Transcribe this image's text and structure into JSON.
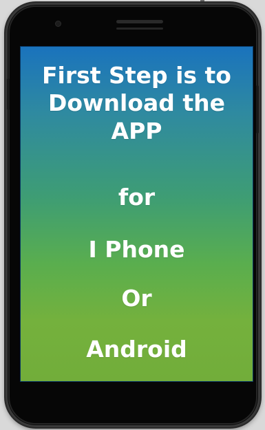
{
  "screen": {
    "lines": [
      "First Step is to",
      "Download the",
      "APP",
      "for",
      "I Phone",
      "Or",
      "Android"
    ],
    "gradient_colors": [
      "#1a73bd",
      "#3e9d74",
      "#74b13d"
    ]
  },
  "device": {
    "body_color": "#0c0c0c",
    "icons": [
      "front-camera-icon",
      "speaker-grille-icon"
    ]
  }
}
